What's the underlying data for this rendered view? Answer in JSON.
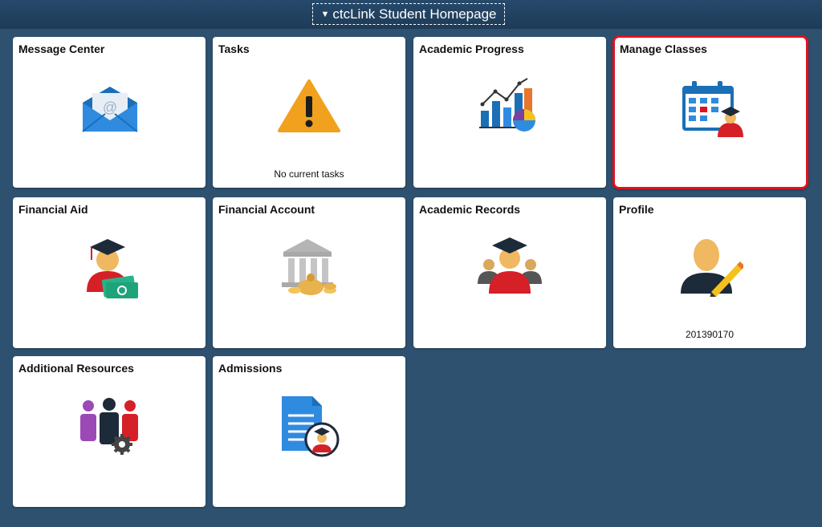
{
  "header": {
    "title": "ctcLink Student Homepage"
  },
  "tiles": [
    {
      "title": "Message Center",
      "subtitle": ""
    },
    {
      "title": "Tasks",
      "subtitle": "No current tasks"
    },
    {
      "title": "Academic Progress",
      "subtitle": ""
    },
    {
      "title": "Manage Classes",
      "subtitle": ""
    },
    {
      "title": "Financial Aid",
      "subtitle": ""
    },
    {
      "title": "Financial Account",
      "subtitle": ""
    },
    {
      "title": "Academic Records",
      "subtitle": ""
    },
    {
      "title": "Profile",
      "subtitle": "201390170"
    },
    {
      "title": "Additional Resources",
      "subtitle": ""
    },
    {
      "title": "Admissions",
      "subtitle": ""
    }
  ],
  "selected_tile": "Manage Classes",
  "colors": {
    "background": "#2f5170",
    "header": "#1d3b58",
    "selected_border": "#e3101d"
  }
}
